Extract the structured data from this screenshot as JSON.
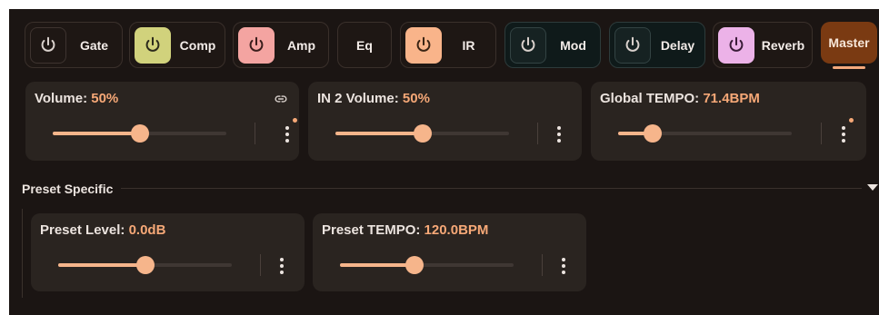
{
  "modules": [
    {
      "id": "gate",
      "label": "Gate",
      "active": false,
      "color": "#1e1714"
    },
    {
      "id": "comp",
      "label": "Comp",
      "active": true,
      "color": "#d1d27c"
    },
    {
      "id": "amp",
      "label": "Amp",
      "active": true,
      "color": "#f4a4a1"
    },
    {
      "id": "eq",
      "label": "Eq",
      "has_power": false
    },
    {
      "id": "ir",
      "label": "IR",
      "active": true,
      "color": "#f9b48a"
    },
    {
      "id": "mod",
      "label": "Mod",
      "active": false,
      "color": "#162222"
    },
    {
      "id": "delay",
      "label": "Delay",
      "active": false,
      "color": "#162222"
    },
    {
      "id": "reverb",
      "label": "Reverb",
      "active": true,
      "color": "#ecb2e8"
    }
  ],
  "master": {
    "label": "Master",
    "selected": true,
    "color": "#7a3a12"
  },
  "params": {
    "volume": {
      "label": "Volume: ",
      "value": "50%",
      "level": 0.5
    },
    "in2_volume": {
      "label": "IN 2 Volume: ",
      "value": "50%",
      "level": 0.5
    },
    "global_tempo": {
      "label": "Global TEMPO: ",
      "value": "71.4BPM",
      "level": 0.2
    }
  },
  "preset_section": {
    "label": "Preset Specific",
    "params": {
      "preset_level": {
        "label": "Preset Level: ",
        "value": "0.0dB",
        "level": 0.5
      },
      "preset_tempo": {
        "label": "Preset TEMPO: ",
        "value": "120.0BPM",
        "level": 0.43
      }
    }
  },
  "icons": {
    "power": "power-icon",
    "link": "link-icon",
    "more": "more-vert-icon",
    "caret": "caret-down-icon"
  },
  "colors": {
    "background": "#1b1513",
    "card": "#2a2420",
    "accent": "#f6a877",
    "slider": "#f6b58b"
  }
}
